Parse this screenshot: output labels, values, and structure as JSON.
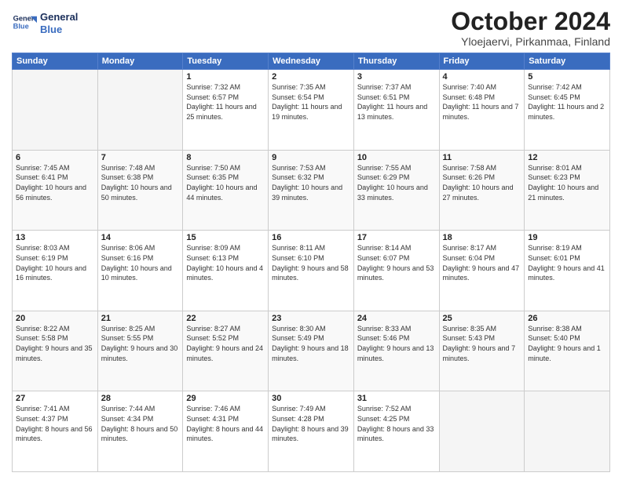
{
  "header": {
    "logo_line1": "General",
    "logo_line2": "Blue",
    "title": "October 2024",
    "subtitle": "Yloejaervi, Pirkanmaa, Finland"
  },
  "days_of_week": [
    "Sunday",
    "Monday",
    "Tuesday",
    "Wednesday",
    "Thursday",
    "Friday",
    "Saturday"
  ],
  "weeks": [
    [
      {
        "day": "",
        "info": ""
      },
      {
        "day": "",
        "info": ""
      },
      {
        "day": "1",
        "info": "Sunrise: 7:32 AM\nSunset: 6:57 PM\nDaylight: 11 hours\nand 25 minutes."
      },
      {
        "day": "2",
        "info": "Sunrise: 7:35 AM\nSunset: 6:54 PM\nDaylight: 11 hours\nand 19 minutes."
      },
      {
        "day": "3",
        "info": "Sunrise: 7:37 AM\nSunset: 6:51 PM\nDaylight: 11 hours\nand 13 minutes."
      },
      {
        "day": "4",
        "info": "Sunrise: 7:40 AM\nSunset: 6:48 PM\nDaylight: 11 hours\nand 7 minutes."
      },
      {
        "day": "5",
        "info": "Sunrise: 7:42 AM\nSunset: 6:45 PM\nDaylight: 11 hours\nand 2 minutes."
      }
    ],
    [
      {
        "day": "6",
        "info": "Sunrise: 7:45 AM\nSunset: 6:41 PM\nDaylight: 10 hours\nand 56 minutes."
      },
      {
        "day": "7",
        "info": "Sunrise: 7:48 AM\nSunset: 6:38 PM\nDaylight: 10 hours\nand 50 minutes."
      },
      {
        "day": "8",
        "info": "Sunrise: 7:50 AM\nSunset: 6:35 PM\nDaylight: 10 hours\nand 44 minutes."
      },
      {
        "day": "9",
        "info": "Sunrise: 7:53 AM\nSunset: 6:32 PM\nDaylight: 10 hours\nand 39 minutes."
      },
      {
        "day": "10",
        "info": "Sunrise: 7:55 AM\nSunset: 6:29 PM\nDaylight: 10 hours\nand 33 minutes."
      },
      {
        "day": "11",
        "info": "Sunrise: 7:58 AM\nSunset: 6:26 PM\nDaylight: 10 hours\nand 27 minutes."
      },
      {
        "day": "12",
        "info": "Sunrise: 8:01 AM\nSunset: 6:23 PM\nDaylight: 10 hours\nand 21 minutes."
      }
    ],
    [
      {
        "day": "13",
        "info": "Sunrise: 8:03 AM\nSunset: 6:19 PM\nDaylight: 10 hours\nand 16 minutes."
      },
      {
        "day": "14",
        "info": "Sunrise: 8:06 AM\nSunset: 6:16 PM\nDaylight: 10 hours\nand 10 minutes."
      },
      {
        "day": "15",
        "info": "Sunrise: 8:09 AM\nSunset: 6:13 PM\nDaylight: 10 hours\nand 4 minutes."
      },
      {
        "day": "16",
        "info": "Sunrise: 8:11 AM\nSunset: 6:10 PM\nDaylight: 9 hours\nand 58 minutes."
      },
      {
        "day": "17",
        "info": "Sunrise: 8:14 AM\nSunset: 6:07 PM\nDaylight: 9 hours\nand 53 minutes."
      },
      {
        "day": "18",
        "info": "Sunrise: 8:17 AM\nSunset: 6:04 PM\nDaylight: 9 hours\nand 47 minutes."
      },
      {
        "day": "19",
        "info": "Sunrise: 8:19 AM\nSunset: 6:01 PM\nDaylight: 9 hours\nand 41 minutes."
      }
    ],
    [
      {
        "day": "20",
        "info": "Sunrise: 8:22 AM\nSunset: 5:58 PM\nDaylight: 9 hours\nand 35 minutes."
      },
      {
        "day": "21",
        "info": "Sunrise: 8:25 AM\nSunset: 5:55 PM\nDaylight: 9 hours\nand 30 minutes."
      },
      {
        "day": "22",
        "info": "Sunrise: 8:27 AM\nSunset: 5:52 PM\nDaylight: 9 hours\nand 24 minutes."
      },
      {
        "day": "23",
        "info": "Sunrise: 8:30 AM\nSunset: 5:49 PM\nDaylight: 9 hours\nand 18 minutes."
      },
      {
        "day": "24",
        "info": "Sunrise: 8:33 AM\nSunset: 5:46 PM\nDaylight: 9 hours\nand 13 minutes."
      },
      {
        "day": "25",
        "info": "Sunrise: 8:35 AM\nSunset: 5:43 PM\nDaylight: 9 hours\nand 7 minutes."
      },
      {
        "day": "26",
        "info": "Sunrise: 8:38 AM\nSunset: 5:40 PM\nDaylight: 9 hours\nand 1 minute."
      }
    ],
    [
      {
        "day": "27",
        "info": "Sunrise: 7:41 AM\nSunset: 4:37 PM\nDaylight: 8 hours\nand 56 minutes."
      },
      {
        "day": "28",
        "info": "Sunrise: 7:44 AM\nSunset: 4:34 PM\nDaylight: 8 hours\nand 50 minutes."
      },
      {
        "day": "29",
        "info": "Sunrise: 7:46 AM\nSunset: 4:31 PM\nDaylight: 8 hours\nand 44 minutes."
      },
      {
        "day": "30",
        "info": "Sunrise: 7:49 AM\nSunset: 4:28 PM\nDaylight: 8 hours\nand 39 minutes."
      },
      {
        "day": "31",
        "info": "Sunrise: 7:52 AM\nSunset: 4:25 PM\nDaylight: 8 hours\nand 33 minutes."
      },
      {
        "day": "",
        "info": ""
      },
      {
        "day": "",
        "info": ""
      }
    ]
  ]
}
